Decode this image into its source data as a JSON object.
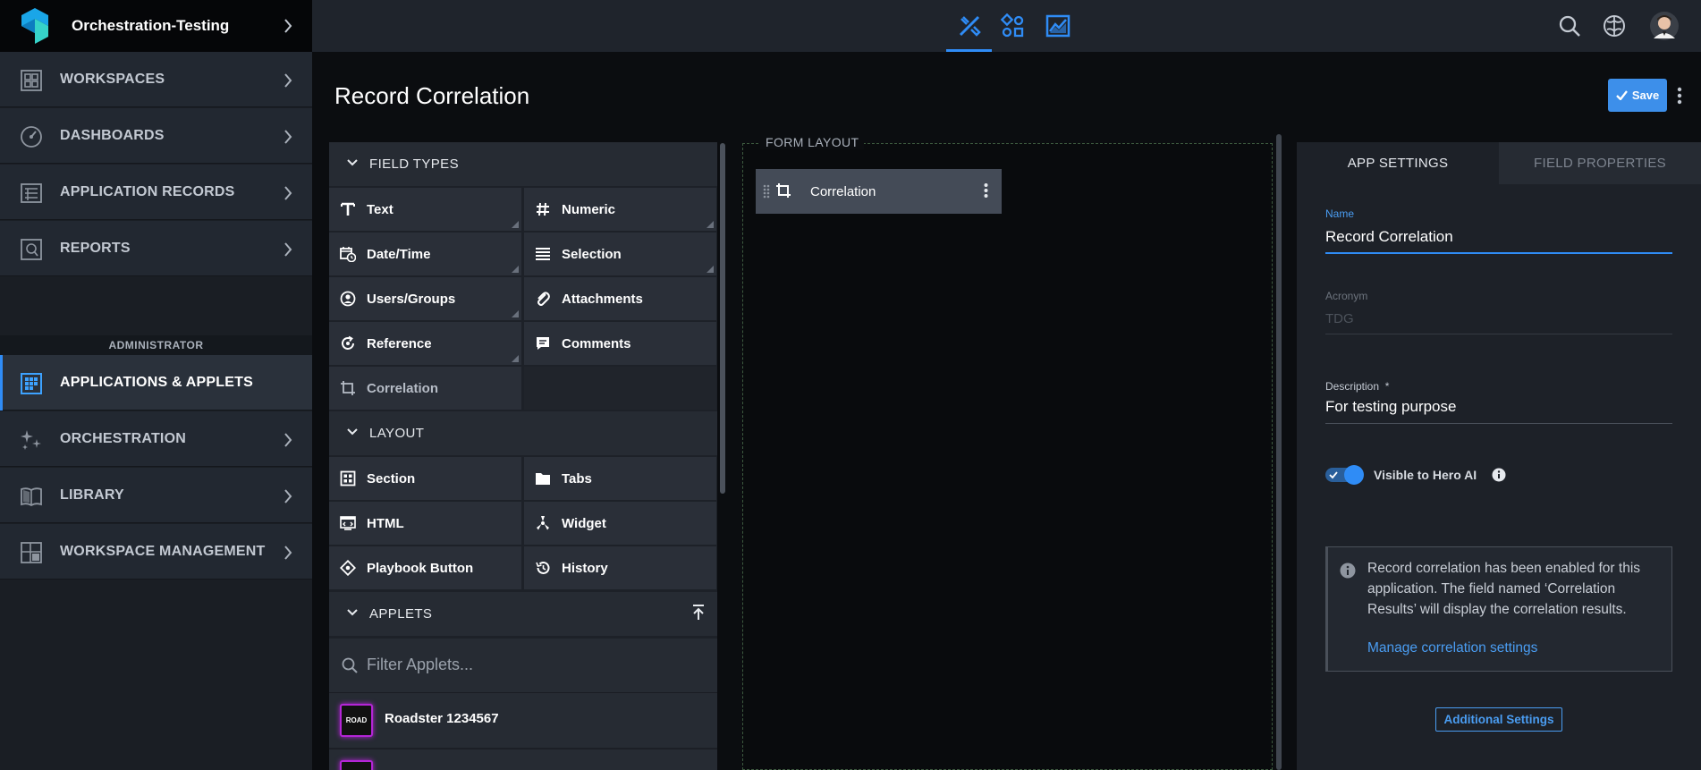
{
  "topbar": {
    "workspace_name": "Orchestration-Testing",
    "tabs": [
      "design-tools-icon",
      "flow-builder-icon",
      "chart-icon"
    ],
    "actions": [
      "search-icon",
      "ai-brain-icon",
      "user-avatar"
    ]
  },
  "sidebar": {
    "items": [
      {
        "label": "WORKSPACES",
        "icon": "workspaces-icon"
      },
      {
        "label": "DASHBOARDS",
        "icon": "dashboard-gauge-icon"
      },
      {
        "label": "APPLICATION RECORDS",
        "icon": "records-icon"
      },
      {
        "label": "REPORTS",
        "icon": "reports-icon"
      },
      {
        "label": "APPLICATIONS & APPLETS",
        "icon": "applications-grid-icon"
      },
      {
        "label": "ORCHESTRATION",
        "icon": "sparkles-icon"
      },
      {
        "label": "LIBRARY",
        "icon": "book-icon"
      },
      {
        "label": "WORKSPACE MANAGEMENT",
        "icon": "workspace-management-icon"
      }
    ],
    "admin_label": "ADMINISTRATOR"
  },
  "page": {
    "title": "Record Correlation",
    "save_label": "Save"
  },
  "palette": {
    "field_types_header": "FIELD TYPES",
    "field_types": [
      "Text",
      "Numeric",
      "Date/Time",
      "Selection",
      "Users/Groups",
      "Attachments",
      "Reference",
      "Comments",
      "Correlation"
    ],
    "layout_header": "LAYOUT",
    "layout": [
      "Section",
      "Tabs",
      "HTML",
      "Widget",
      "Playbook Button",
      "History"
    ],
    "applets_header": "APPLETS",
    "filter_placeholder": "Filter Applets...",
    "applets": [
      {
        "badge": "ROAD",
        "name": "Roadster 1234567"
      }
    ]
  },
  "form_layout": {
    "legend": "FORM LAYOUT",
    "fields": [
      "Correlation"
    ]
  },
  "settings": {
    "tabs": [
      "APP SETTINGS",
      "FIELD PROPERTIES"
    ],
    "name_label": "Name",
    "name_value": "Record Correlation",
    "acronym_label": "Acronym",
    "acronym_placeholder": "TDG",
    "description_label": "Description",
    "description_required": "*",
    "description_value": "For testing purpose",
    "visible_to_ai_label": "Visible to Hero AI",
    "visible_to_ai_enabled": true,
    "info_text": "Record correlation has been enabled for this application. The field named ‘Correlation Results’ will display the correlation results.",
    "info_link": "Manage correlation settings",
    "additional_settings_label": "Additional Settings",
    "accent_color": "#2f8cf6"
  }
}
